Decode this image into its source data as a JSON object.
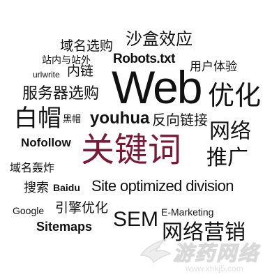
{
  "word_cloud": {
    "words": {
      "yumingxuangou": "域名选购",
      "shahexiaoying": "沙盒效应",
      "zhanneiyuzhanwai": "站内与站外",
      "robots": "Robots.txt",
      "urlwrite": "urlwrite",
      "neilian": "内链",
      "yonghutiyan": "用户体验",
      "web": "Web",
      "youhua_cn": "优化",
      "fuwuqi": "服务器选购",
      "baimao": "白帽",
      "heimao": "黑帽",
      "youhua_py": "youhua",
      "fanxiang": "反向链接",
      "wangluo": "网络",
      "nofollow": "Nofollow",
      "guanjianci": "关键词",
      "tuiguang": "推广",
      "yumingbaozha": "域名轰炸",
      "sousuo": "搜索",
      "baidu": "Baidu",
      "site": "Site optimized division",
      "google": "Google",
      "yinqing": "引擎优化",
      "sem": "SEM",
      "emarketing": "E-Marketing",
      "sitemaps": "Sitemaps",
      "wangluoyingxiao": "网络营销"
    },
    "highlight_color": "#7b1836",
    "text_color": "#111111"
  },
  "watermark": {
    "name": "游药网络",
    "url": "www.xhkj5.com",
    "icon": "dove-logo-icon"
  }
}
